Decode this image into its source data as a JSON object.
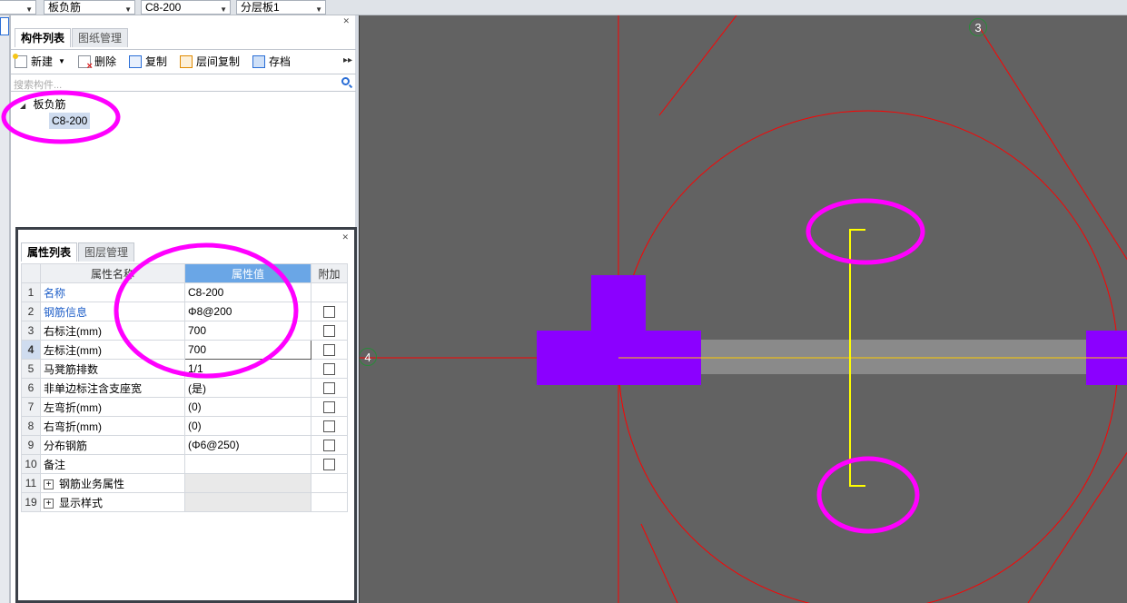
{
  "toolbar": {
    "combo_category": "板负筋",
    "combo_component": "C8-200",
    "combo_layer": "分层板1"
  },
  "component_panel": {
    "tabs": [
      "构件列表",
      "图纸管理"
    ],
    "actions": {
      "new": "新建",
      "delete": "删除",
      "copy": "复制",
      "floor_copy": "层间复制",
      "save": "存档"
    },
    "search_placeholder": "搜索构件...",
    "tree": {
      "parent": "板负筋",
      "child": "C8-200"
    }
  },
  "property_panel": {
    "tabs": [
      "属性列表",
      "图层管理"
    ],
    "columns": {
      "name": "属性名称",
      "value": "属性值",
      "extra": "附加"
    },
    "rows": [
      {
        "num": "1",
        "name": "名称",
        "value": "C8-200",
        "blue": true,
        "checkbox": false
      },
      {
        "num": "2",
        "name": "钢筋信息",
        "value": "Φ8@200",
        "blue": true,
        "checkbox": true
      },
      {
        "num": "3",
        "name": "右标注(mm)",
        "value": "700",
        "blue": false,
        "checkbox": true
      },
      {
        "num": "4",
        "name": "左标注(mm)",
        "value": "700",
        "blue": false,
        "checkbox": true,
        "selected": true
      },
      {
        "num": "5",
        "name": "马凳筋排数",
        "value": "1/1",
        "blue": false,
        "checkbox": true
      },
      {
        "num": "6",
        "name": "非单边标注含支座宽",
        "value": "(是)",
        "blue": false,
        "checkbox": true
      },
      {
        "num": "7",
        "name": "左弯折(mm)",
        "value": "(0)",
        "blue": false,
        "checkbox": true
      },
      {
        "num": "8",
        "name": "右弯折(mm)",
        "value": "(0)",
        "blue": false,
        "checkbox": true
      },
      {
        "num": "9",
        "name": "分布钢筋",
        "value": "(Φ6@250)",
        "blue": false,
        "checkbox": true
      },
      {
        "num": "10",
        "name": "备注",
        "value": "",
        "blue": false,
        "checkbox": true
      },
      {
        "num": "11",
        "name": "钢筋业务属性",
        "value": "",
        "group": true
      },
      {
        "num": "19",
        "name": "显示样式",
        "value": "",
        "group": true
      }
    ]
  },
  "canvas": {
    "axis_labels": [
      "3",
      "4"
    ],
    "colors": {
      "background": "#626262",
      "axis_line": "#ff0000",
      "beam": "#8b00ff",
      "slab_strip": "#8a8a8a",
      "rebar": "#ffff00",
      "annotation": "#ff00ff"
    }
  }
}
